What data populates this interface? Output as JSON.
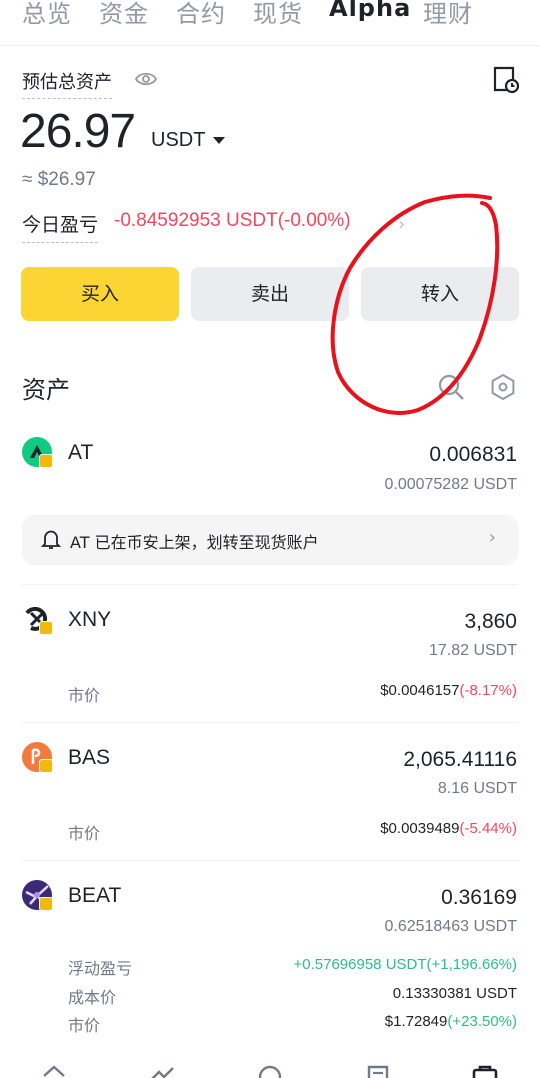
{
  "tabs": [
    {
      "label": "总览"
    },
    {
      "label": "资金"
    },
    {
      "label": "合约"
    },
    {
      "label": "现货"
    },
    {
      "label": "Alpha",
      "active": true
    },
    {
      "label": "理财"
    }
  ],
  "balance": {
    "label": "预估总资产",
    "value": "26.97",
    "unit": "USDT",
    "approx": "≈ $26.97"
  },
  "pnl": {
    "label": "今日盈亏",
    "value": "-0.84592953 USDT(-0.00%)",
    "chevron": "›"
  },
  "actions": {
    "buy": "买入",
    "sell": "卖出",
    "transfer": "转入"
  },
  "assets": {
    "title": "资产",
    "notice": {
      "text": "AT 已在币安上架，划转至现货账户",
      "chevron": "›"
    },
    "items": [
      {
        "symbol": "AT",
        "amount": "0.006831",
        "usdt": "0.00075282 USDT",
        "icon": "at-coin-icon",
        "color": "#0ecb81"
      },
      {
        "symbol": "XNY",
        "amount": "3,860",
        "usdt": "17.82 USDT",
        "price_label": "市价",
        "price": "$0.0046157",
        "change": "(-8.17%)",
        "icon": "xny-coin-icon",
        "color": "#1e2329"
      },
      {
        "symbol": "BAS",
        "amount": "2,065.41116",
        "usdt": "8.16 USDT",
        "price_label": "市价",
        "price": "$0.0039489",
        "change": "(-5.44%)",
        "icon": "bas-coin-icon",
        "color": "#f27a3b"
      },
      {
        "symbol": "BEAT",
        "amount": "0.36169",
        "usdt": "0.62518463 USDT",
        "float_label": "浮动盈亏",
        "float_value": "+0.57696958 USDT(+1,196.66%)",
        "cost_label": "成本价",
        "cost_value": "0.13330381 USDT",
        "price_label": "市价",
        "price": "$1.72849",
        "change": "(+23.50%)",
        "icon": "beat-coin-icon",
        "color": "#7b5cff"
      }
    ]
  },
  "colors": {
    "accent": "#fcd535",
    "negative": "#f6465d",
    "positive": "#2ebd85",
    "annotation": "#e8111c"
  },
  "bottom_nav": [
    "home-icon",
    "markets-icon",
    "discover-icon",
    "orders-icon",
    "wallet-icon"
  ]
}
